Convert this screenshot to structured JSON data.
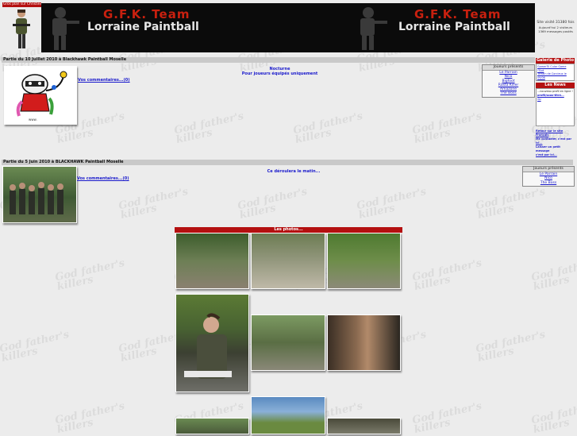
{
  "header": {
    "top_link": "Gros plan sur Christine",
    "team_name": "G.F.K. Team",
    "subtitle": "Lorraine Paintball",
    "stats": [
      "Site visité 31380 fois",
      "Aujourd'hui 2 visiteurs",
      "1369 messages postés"
    ]
  },
  "watermark": [
    "God father's",
    "killers"
  ],
  "sections": [
    {
      "title": "Partie du 10 Juillet 2010 à Blackhawk Paintball Moselle",
      "comments_link": "Vos commentaires...(0)",
      "info_lines": [
        "Nocturne",
        "Pour joueurs équipés uniquement"
      ],
      "players_title": "Joueurs présents",
      "players": [
        "Le Parrain",
        "Nico",
        "Bigfoot",
        "Rasta Killer",
        "Amazone",
        "The Boss"
      ]
    },
    {
      "title": "Partie du 5 Juin 2010 à BLACKHAWK Paintball Moselle",
      "comments_link": "Vos commentaires...(0)",
      "info_lines": [
        "Ce déroulera le matin..."
      ],
      "players_title": "Joueurs présents",
      "players": [
        "Le Parrain",
        "Nico",
        "The Boss"
      ]
    }
  ],
  "gallery_title": "Les photos...",
  "right_column": {
    "gallery_header": "Galerie de Photo",
    "gallery_items": [
      "Gamer?Il Cuíar Game",
      "l'Sud",
      "Terrain de Corcieux le 09/06"
    ],
    "news_header": "Les News",
    "news_lines": [
      "...nouveau profil en ligne !",
      "profil/sous-titre...",
      "lisi"
    ],
    "bottom_lines": [
      "Retour sur le site Français",
      "Me contacter, c'est par",
      "ici...",
      "Laisser un petit message",
      "c'est par ici..."
    ]
  },
  "colors": {
    "accent_red": "#b41010",
    "banner_bg": "#0b0b0b",
    "link": "#1a1acc"
  }
}
